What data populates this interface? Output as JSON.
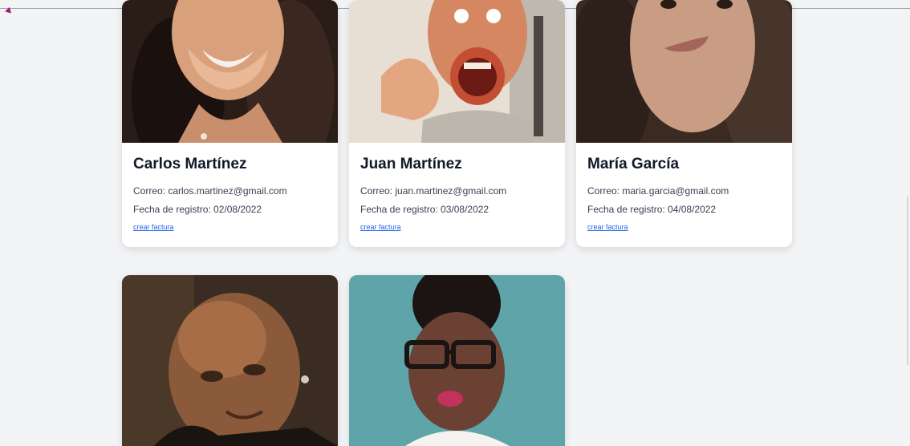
{
  "users": [
    {
      "name": "Carlos Martínez",
      "email_label": "Correo: carlos.martinez@gmail.com",
      "date_label": "Fecha de registro: 02/08/2022",
      "action": "crear factura"
    },
    {
      "name": "Juan Martínez",
      "email_label": "Correo: juan.martinez@gmail.com",
      "date_label": "Fecha de registro: 03/08/2022",
      "action": "crear factura"
    },
    {
      "name": "María García",
      "email_label": "Correo: maria.garcia@gmail.com",
      "date_label": "Fecha de registro: 04/08/2022",
      "action": "crear factura"
    },
    {
      "name": "",
      "email_label": "",
      "date_label": "",
      "action": ""
    },
    {
      "name": "",
      "email_label": "",
      "date_label": "",
      "action": ""
    }
  ],
  "colors": {
    "background": "#f3f4f6",
    "card": "#ffffff",
    "link": "#2563eb"
  }
}
